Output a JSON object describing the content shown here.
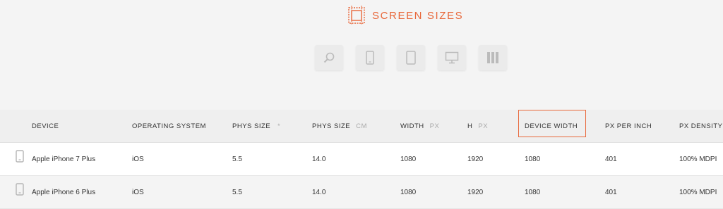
{
  "header": {
    "logo_text": "SCREEN SIZES",
    "logo_icon": "frame-cube-icon"
  },
  "filters": [
    {
      "icon": "search-icon"
    },
    {
      "icon": "phone-icon"
    },
    {
      "icon": "tablet-icon"
    },
    {
      "icon": "monitor-icon"
    },
    {
      "icon": "columns-icon"
    }
  ],
  "table": {
    "columns": [
      {
        "label": "DEVICE",
        "unit": ""
      },
      {
        "label": "OPERATING SYSTEM",
        "unit": ""
      },
      {
        "label": "PHYS SIZE",
        "unit": "",
        "sort": "*"
      },
      {
        "label": "PHYS SIZE",
        "unit": "CM"
      },
      {
        "label": "WIDTH",
        "unit": "PX"
      },
      {
        "label": "H",
        "unit": "PX"
      },
      {
        "label": "DEVICE WIDTH",
        "unit": ""
      },
      {
        "label": "PX PER INCH",
        "unit": ""
      },
      {
        "label": "PX DENSITY",
        "unit": ""
      }
    ],
    "rows": [
      {
        "device": "Apple iPhone 7 Plus",
        "os": "iOS",
        "phys_in": "5.5",
        "phys_cm": "14.0",
        "width": "1080",
        "height": "1920",
        "device_width": "1080",
        "ppi": "401",
        "density": "100% MDPI"
      },
      {
        "device": "Apple iPhone 6 Plus",
        "os": "iOS",
        "phys_in": "5.5",
        "phys_cm": "14.0",
        "width": "1080",
        "height": "1920",
        "device_width": "1080",
        "ppi": "401",
        "density": "100% MDPI"
      }
    ]
  },
  "colors": {
    "accent": "#e8673a",
    "header_bg": "#efefef",
    "row_alt": "#f4f4f4"
  }
}
